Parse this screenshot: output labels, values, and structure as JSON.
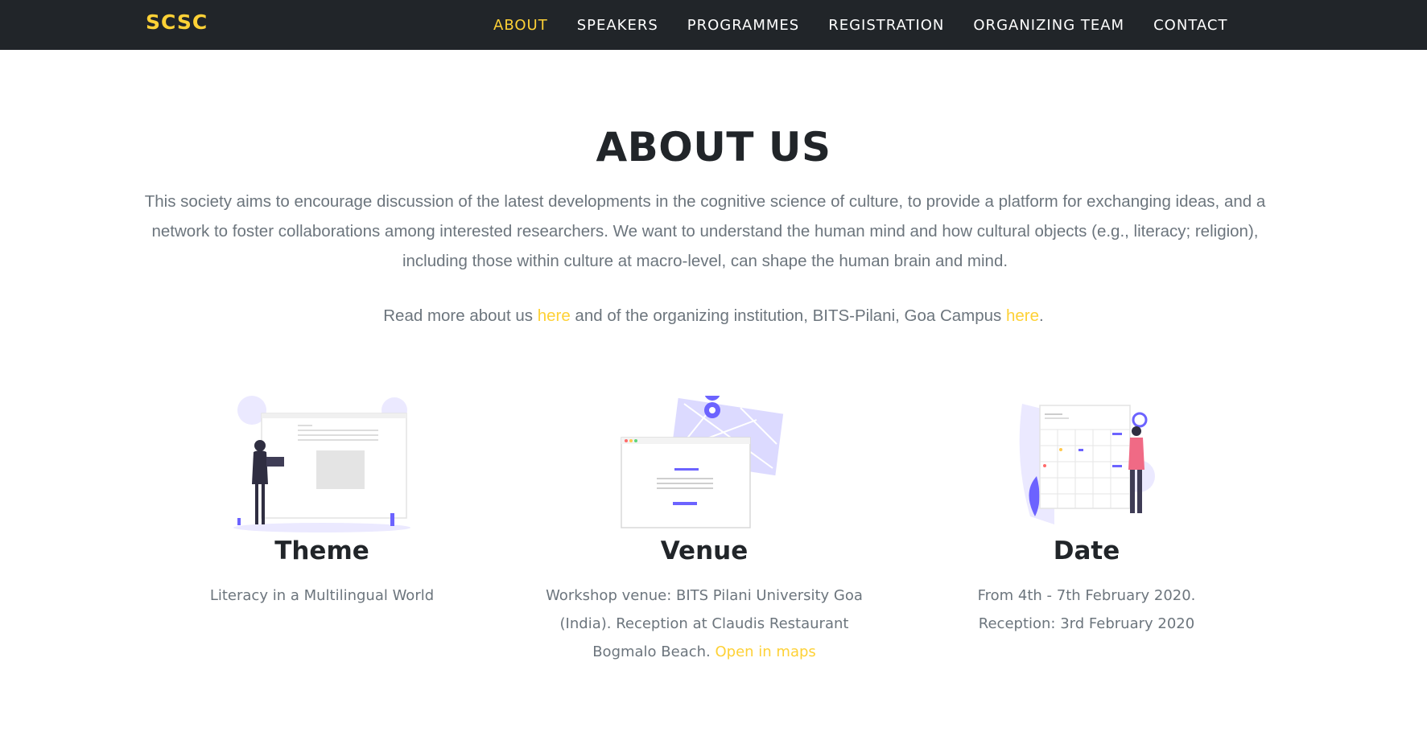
{
  "nav": {
    "brand": "SCSC",
    "links": [
      "ABOUT",
      "SPEAKERS",
      "PROGRAMMES",
      "REGISTRATION",
      "ORGANIZING TEAM",
      "CONTACT"
    ],
    "active": "ABOUT"
  },
  "about": {
    "heading": "ABOUT US",
    "intro": "This society aims to encourage discussion of the latest developments in the cognitive science of culture, to provide a platform for exchanging ideas, and a network to foster collaborations among interested researchers. We want to understand the human mind and how cultural objects (e.g., literacy; religion), including those within culture at macro-level, can shape the human brain and mind.",
    "readmore": {
      "part1": "Read more about us ",
      "link1": "here",
      "part2": " and of the organizing institution, BITS-Pilani, Goa Campus ",
      "link2": "here",
      "part3": "."
    }
  },
  "features": {
    "theme": {
      "title": "Theme",
      "text": "Literacy in a Multilingual World",
      "icon": "presentation-illustration"
    },
    "venue": {
      "title": "Venue",
      "text": "Workshop venue: BITS Pilani University Goa (India). Reception at Claudis Restaurant Bogmalo Beach. ",
      "link": "Open in maps",
      "icon": "map-illustration"
    },
    "date": {
      "title": "Date",
      "line1": "From 4th - 7th February 2020.",
      "line2": "Reception: 3rd February 2020",
      "icon": "calendar-illustration"
    }
  },
  "colors": {
    "accent": "#fed136",
    "navbar": "#212529",
    "illustration": "#6c63ff"
  }
}
